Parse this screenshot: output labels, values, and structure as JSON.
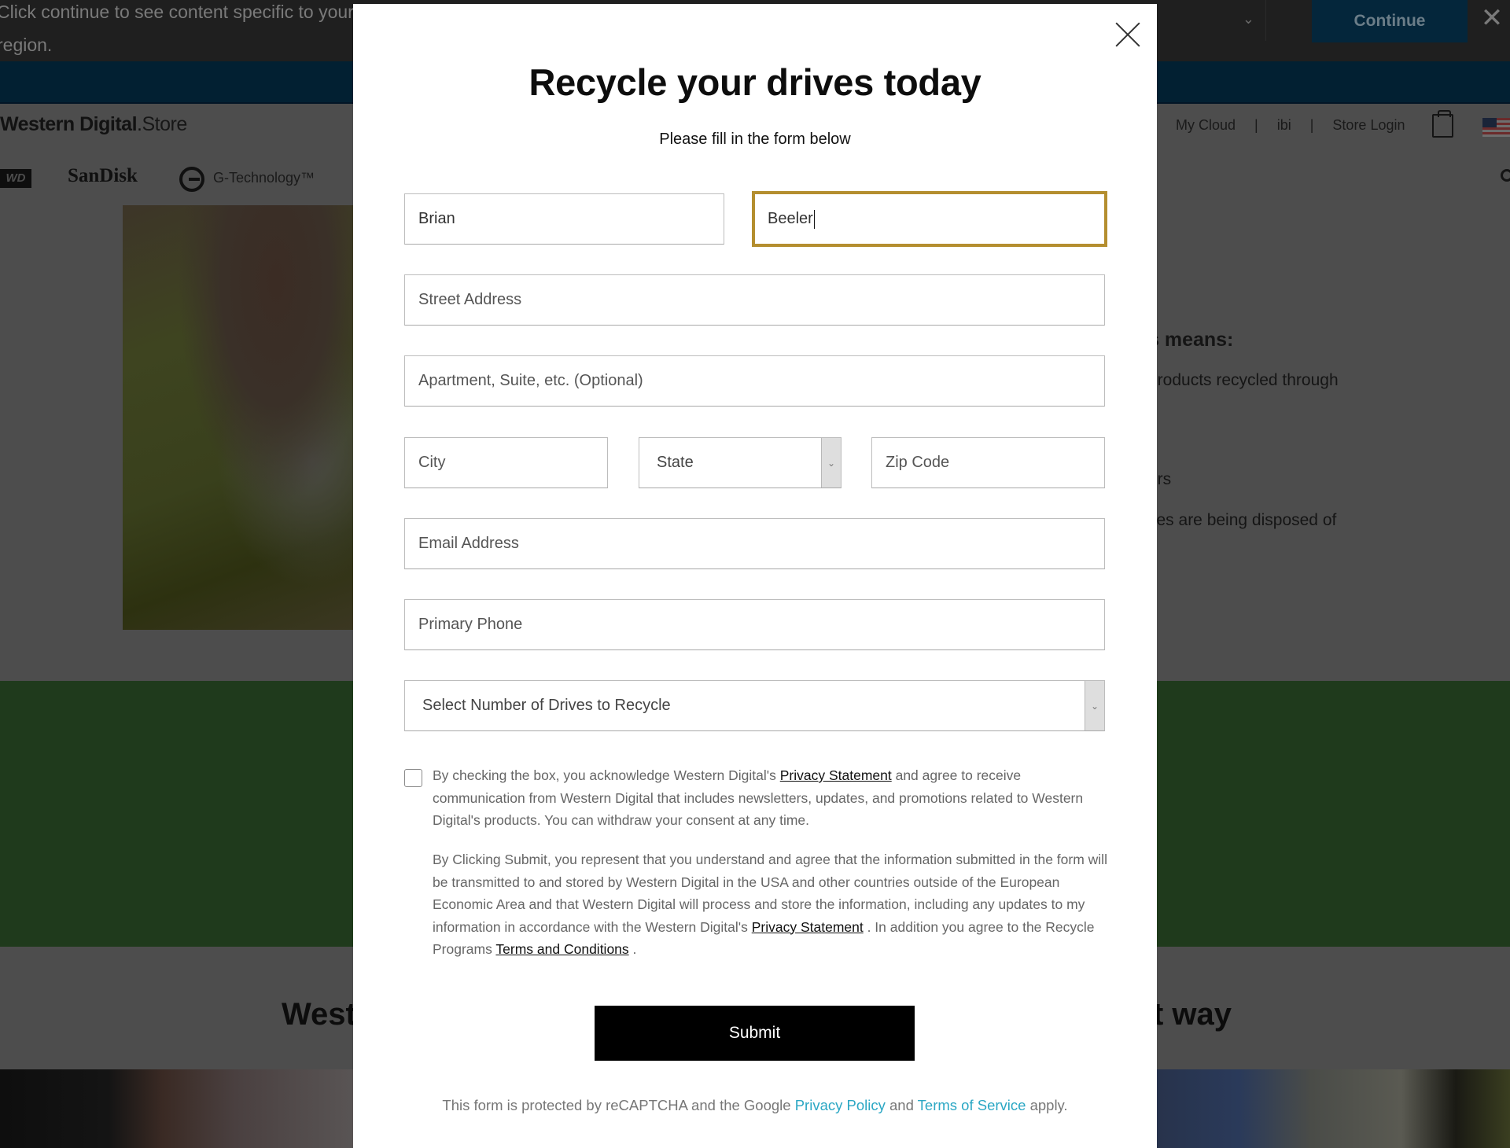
{
  "background": {
    "region_banner": {
      "text": "Click continue to see content specific to your region.",
      "continue_label": "Continue",
      "close_icon": "close-icon",
      "select_icon": "chevron-down-icon"
    },
    "header": {
      "logo_bold": "Western Digital",
      "logo_dot": ".",
      "logo_store": "Store",
      "links": [
        "My Cloud",
        "ibi",
        "Store Login"
      ],
      "separator": "|",
      "cart_icon": "shopping-bag-icon",
      "flag_icon": "us-flag-icon",
      "brands": {
        "wd": "WD",
        "sandisk": "SanDisk",
        "gtech": "G-Technology™"
      }
    },
    "content": {
      "means_heading": "s means:",
      "means_lines": [
        "products recycled through",
        "ers",
        "ves are being disposed of"
      ],
      "section_heading_left": "West",
      "section_heading_right": "t way"
    }
  },
  "modal": {
    "title": "Recycle your drives today",
    "subtitle": "Please fill in the form below",
    "close_icon": "close-icon",
    "fields": {
      "first_name": {
        "value": "Brian"
      },
      "last_name": {
        "value": "Beeler",
        "focused": true
      },
      "street": {
        "placeholder": "Street Address"
      },
      "apartment": {
        "placeholder": "Apartment, Suite, etc. (Optional)"
      },
      "city": {
        "placeholder": "City"
      },
      "state": {
        "selected": "State"
      },
      "zip": {
        "placeholder": "Zip Code"
      },
      "email": {
        "placeholder": "Email Address"
      },
      "phone": {
        "placeholder": "Primary Phone"
      },
      "drives": {
        "selected": "Select Number of Drives to Recycle"
      }
    },
    "consent": {
      "checked": false,
      "text_before": "By checking the box, you acknowledge Western Digital's ",
      "link": "Privacy Statement",
      "text_after": " and agree to receive communication from Western Digital that includes newsletters, updates, and promotions related to Western Digital's products. You can withdraw your consent at any time."
    },
    "legal": {
      "text_1": "By Clicking Submit, you represent that you understand and agree that the information submitted in the form will be transmitted to and stored by Western Digital in the USA and other countries outside of the European Economic Area and that Western Digital will process and store the information, including any updates to my information in accordance with the Western Digital's ",
      "link_1": "Privacy Statement",
      "text_2": " . In addition you agree to the Recycle Programs ",
      "link_2": "Terms and Conditions",
      "text_3": " ."
    },
    "submit_label": "Submit",
    "recaptcha": {
      "text_1": "This form is protected by reCAPTCHA and the Google ",
      "link_1": "Privacy Policy",
      "text_2": " and ",
      "link_2": "Terms of Service",
      "text_3": " apply."
    }
  },
  "colors": {
    "focus_border": "#b48e2f",
    "recaptcha_link": "#2ba7c4",
    "submit_bg": "#000000",
    "overlay_gray": "#4d4d4d",
    "green_band": "#1f3a1c"
  }
}
